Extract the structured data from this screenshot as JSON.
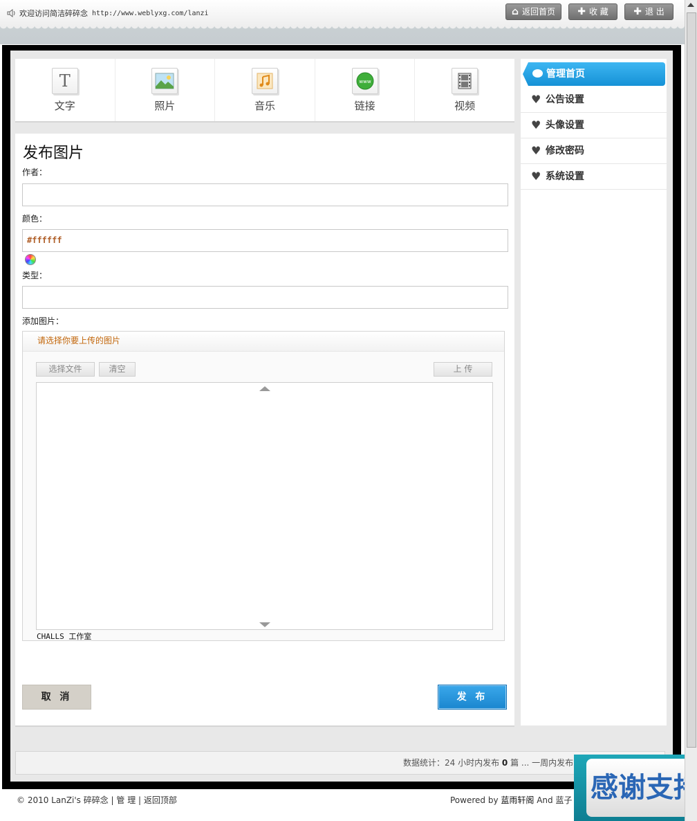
{
  "topbar": {
    "welcome": "欢迎访问简洁碎碎念",
    "url": "http://www.weblyxg.com/lanzi",
    "buttons": [
      {
        "label": "返回首页",
        "icon": "home-icon"
      },
      {
        "label": "收 藏",
        "icon": "plus-icon"
      },
      {
        "label": "退 出",
        "icon": "plus-icon"
      }
    ]
  },
  "categories": [
    {
      "label": "文字",
      "icon": "text-icon"
    },
    {
      "label": "照片",
      "icon": "photo-icon"
    },
    {
      "label": "音乐",
      "icon": "music-icon"
    },
    {
      "label": "链接",
      "icon": "link-icon"
    },
    {
      "label": "视频",
      "icon": "video-icon"
    }
  ],
  "form": {
    "title": "发布图片",
    "author_label": "作者：",
    "author_value": "",
    "color_label": "颜色：",
    "color_value": "#ffffff",
    "type_label": "类型：",
    "type_value": "",
    "add_image_label": "添加图片："
  },
  "uploader": {
    "header": "请选择你要上传的图片",
    "select_file": "选择文件",
    "clear": "清空",
    "upload": "上 传",
    "credit": "CHALLS 工作室"
  },
  "actions": {
    "cancel": "取 消",
    "publish": "发 布"
  },
  "sidebar": {
    "active": "管理首页",
    "items": [
      "公告设置",
      "头像设置",
      "修改密码",
      "系统设置"
    ]
  },
  "stats": {
    "prefix": "数据统计：24 小时内发布",
    "count": "0",
    "suffix": "篇 ... 一周内发布"
  },
  "footer": {
    "copyright": "© 2010 LanZi's 碎碎念 | 管 理 | 返回顶部",
    "powered_prefix": "Powered by ",
    "powered_name": "蓝雨轩阁",
    "powered_and": " And 蓝子"
  },
  "banner": {
    "text": "感谢支持"
  }
}
